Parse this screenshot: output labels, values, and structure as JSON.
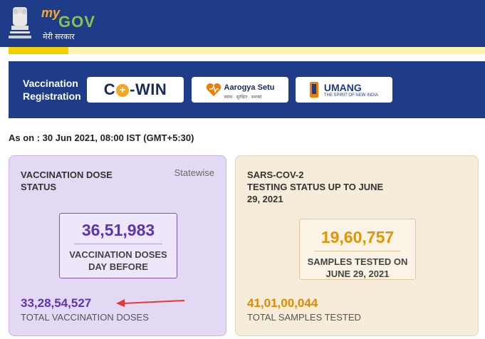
{
  "header": {
    "logo_my": "my",
    "logo_gov": "GOV",
    "logo_hindi": "मेरी सरकार",
    "emblem_icon": "state-emblem-icon",
    "background": "#1f3c88"
  },
  "progress_strip": {
    "fill_fraction": 0.125,
    "color": "#f5d000"
  },
  "vaccination_registration": {
    "label": "Vaccination Registration",
    "cowin_prefix": "C",
    "cowin_suffix": "-WIN",
    "arogya_label": "Aarogya Setu",
    "arogya_sub": "स्वस्थ · सुरक्षित · सशक्त",
    "umang_label": "UMANG",
    "umang_sub": "THE SPIRIT OF NEW INDIA"
  },
  "as_on": "As on : 30 Jun 2021, 08:00 IST (GMT+5:30)",
  "vaccination_card": {
    "title_line1": "VACCINATION DOSE",
    "title_line2": "STATUS",
    "statewise": "Statewise",
    "day_before_value": "36,51,983",
    "day_before_line1": "VACCINATION DOSES",
    "day_before_line2": "DAY BEFORE",
    "total_value": "33,28,54,527",
    "total_label": "TOTAL VACCINATION DOSES",
    "accent": "#5e35b1"
  },
  "testing_card": {
    "title_line1": "SARS-COV-2",
    "title_line2": "TESTING STATUS UP TO JUNE",
    "title_line3": "29, 2021",
    "samples_value": "19,60,757",
    "samples_line1": "SAMPLES TESTED ON",
    "samples_line2": "JUNE 29, 2021",
    "total_value": "41,01,00,044",
    "total_label": "TOTAL SAMPLES TESTED",
    "accent": "#e59400"
  },
  "annotation": {
    "arrow_icon": "red-arrow-icon",
    "color": "#e53935"
  }
}
